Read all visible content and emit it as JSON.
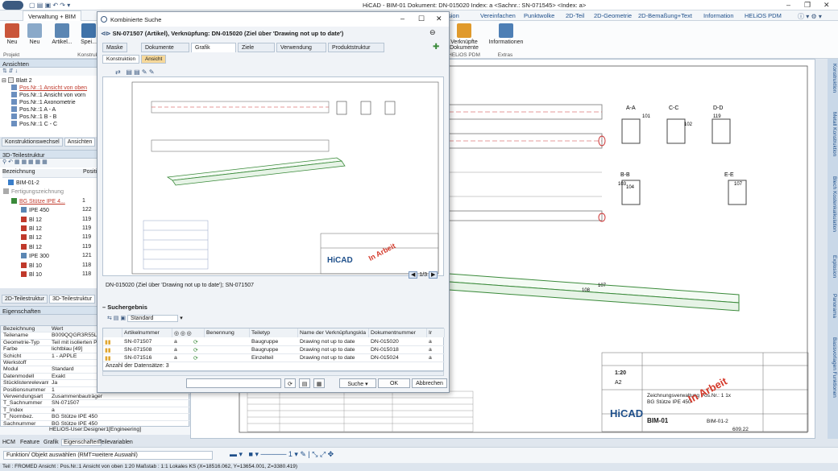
{
  "window": {
    "title": "HiCAD - BIM-01   Dokument: DN-015020   Index: a   <Sachnr.: SN-071545>   <Index: a>"
  },
  "ribbon_tabs": [
    "Verwaltung + BIM",
    "sion",
    "Vereinfachen",
    "Punktwolke",
    "2D-Teil",
    "2D-Geometrie",
    "2D-Bemaßung+Text",
    "Information",
    "HELiOS PDM"
  ],
  "ribbon": {
    "buttons": [
      "Neu",
      "Neu",
      "Artikel...",
      "Spei...",
      "Verknüpfte Dokumente",
      "Informationen"
    ],
    "groups": [
      "Projekt",
      "Konstruk",
      "HELiOS PDM",
      "Extras"
    ]
  },
  "left": {
    "ansichten_title": "Ansichten",
    "blatt": "Blatt 2",
    "views": [
      "Pos.Nr.:1 Ansicht von oben",
      "Pos.Nr.:1 Ansicht von vorn",
      "Pos.Nr.:1 Axonometrie",
      "Pos.Nr.:1 A - A",
      "Pos.Nr.:1 B - B",
      "Pos.Nr.:1 C - C"
    ],
    "view_tabs": [
      "Konstruktionswechsel",
      "Ansichten"
    ],
    "teilestruktur_title": "3D-Teilestruktur",
    "col_bez": "Bezeichnung",
    "col_pos": "Positi",
    "parts": [
      {
        "name": "BIM-01-2",
        "pos": ""
      },
      {
        "name": "Fertigungszeichnung",
        "pos": ""
      },
      {
        "name": "BG Stütze IPE 4...",
        "pos": "1"
      },
      {
        "name": "IPE 450",
        "pos": "122"
      },
      {
        "name": "Bl 12",
        "pos": "119"
      },
      {
        "name": "Bl 12",
        "pos": "119"
      },
      {
        "name": "Bl 12",
        "pos": "119"
      },
      {
        "name": "Bl 12",
        "pos": "119"
      },
      {
        "name": "IPE 300",
        "pos": "121"
      },
      {
        "name": "Bl 10",
        "pos": "118"
      },
      {
        "name": "Bl 10",
        "pos": "118"
      }
    ],
    "struct_tabs": [
      "2D-Teilestruktur",
      "3D-Teilestruktur"
    ],
    "props_title": "Eigenschaften",
    "props_head": {
      "k": "Bezeichnung",
      "v": "Wert"
    },
    "props": [
      {
        "k": "Teilename",
        "v": "B009QQGR3R55LI..."
      },
      {
        "k": "Geometrie-Typ",
        "v": "Teil mit isolierten P..."
      },
      {
        "k": "Farbe",
        "v": "lichtblau [49]"
      },
      {
        "k": "Schicht",
        "v": "1 - APPLE"
      },
      {
        "k": "Werkstoff",
        "v": ""
      },
      {
        "k": "Modul",
        "v": "Standard"
      },
      {
        "k": "Datenmodell",
        "v": "Exakt"
      },
      {
        "k": "Stücklistenrelevant",
        "v": "Ja"
      },
      {
        "k": "Positionsnummer",
        "v": "1"
      },
      {
        "k": "Verwendungsart",
        "v": "Zusammenbauträger"
      },
      {
        "k": "T_Sachnummer",
        "v": "SN-071507"
      },
      {
        "k": "T_Index",
        "v": "a"
      },
      {
        "k": "T_Normbez.",
        "v": "BG Stütze IPE 450"
      },
      {
        "k": "Sachnummer",
        "v": "BG Stütze IPE 450"
      }
    ],
    "user": "HELiOS-User:Designer1[Engineering]",
    "bottom_tabs": [
      "HCM",
      "Feature",
      "Grafik",
      "Eigenschaften",
      "Teilevariablen"
    ]
  },
  "dialog": {
    "title": "Kombinierte Suche",
    "item": "SN-071507 (Artikel), Verknüpfung: DN-015020 (Ziel über 'Drawing not up to date')",
    "tabs": [
      "Maske",
      "Dokumente",
      "Grafik",
      "Ziele",
      "Verwendung",
      "Produktstruktur"
    ],
    "subtabs": [
      "Konstruktion",
      "Ansicht"
    ],
    "path": "DN-015020 (Ziel über 'Drawing not up to date'); SN-071507",
    "page": "1/3",
    "section": "Suchergebnis",
    "standard": "Standard",
    "cols": [
      "Artikelnummer",
      "Benennung",
      "Teiletyp",
      "Name der Verknüpfungskla",
      "Dokumentnummer",
      "Ir"
    ],
    "rows": [
      {
        "nr": "SN-071507",
        "idx": "a",
        "typ": "Baugruppe",
        "link": "Drawing not up to date",
        "doc": "DN-015020",
        "di": "a"
      },
      {
        "nr": "SN-071508",
        "idx": "a",
        "typ": "Baugruppe",
        "link": "Drawing not up to date",
        "doc": "DN-015018",
        "di": "a"
      },
      {
        "nr": "SN-071516",
        "idx": "a",
        "typ": "Einzelteil",
        "link": "Drawing not up to date",
        "doc": "DN-015024",
        "di": "a"
      }
    ],
    "count": "Anzahl der Datensätze: 3",
    "btn_search": "Suche",
    "btn_ok": "OK",
    "btn_cancel": "Abbrechen"
  },
  "drawing": {
    "sections": [
      "A-A",
      "C-C",
      "D-D",
      "B-B",
      "E-E"
    ],
    "dims": [
      "101",
      "102",
      "119",
      "103",
      "104",
      "107",
      "108",
      "107"
    ],
    "title_block": {
      "logo": "HiCAD",
      "name": "BIM-01",
      "doc": "BIM-01-2",
      "scale": "1:20",
      "format": "A2",
      "desc": "Zeichnungsverwaltung Pos.Nr.: 1 1x BG Stütze IPE 450",
      "weight": "609.22",
      "stamp": "In Arbeit"
    }
  },
  "sidebar_tabs": [
    "Konstruktion",
    "Metall Konstruktion",
    "Blech Kostenkalkulation",
    "Explosion",
    "Panorama",
    "Basisvorlagen Funktionen"
  ],
  "status": {
    "prompt": "Funktion/ Objekt auswählen (RMT=weitere Auswahl)",
    "coords": "Teil : FROMED   Ansicht : Pos.Nr.:1 Ansicht von oben 1:20   Maßstab : 1:1   Lokales KS  (X=18516.062, Y=13654.001, Z=3380.419)"
  },
  "colors": {
    "accent": "#1e4f8a",
    "stamp": "#d43a2b",
    "beam": "#3a8a3a",
    "ribbon_active": "#ffffff"
  }
}
